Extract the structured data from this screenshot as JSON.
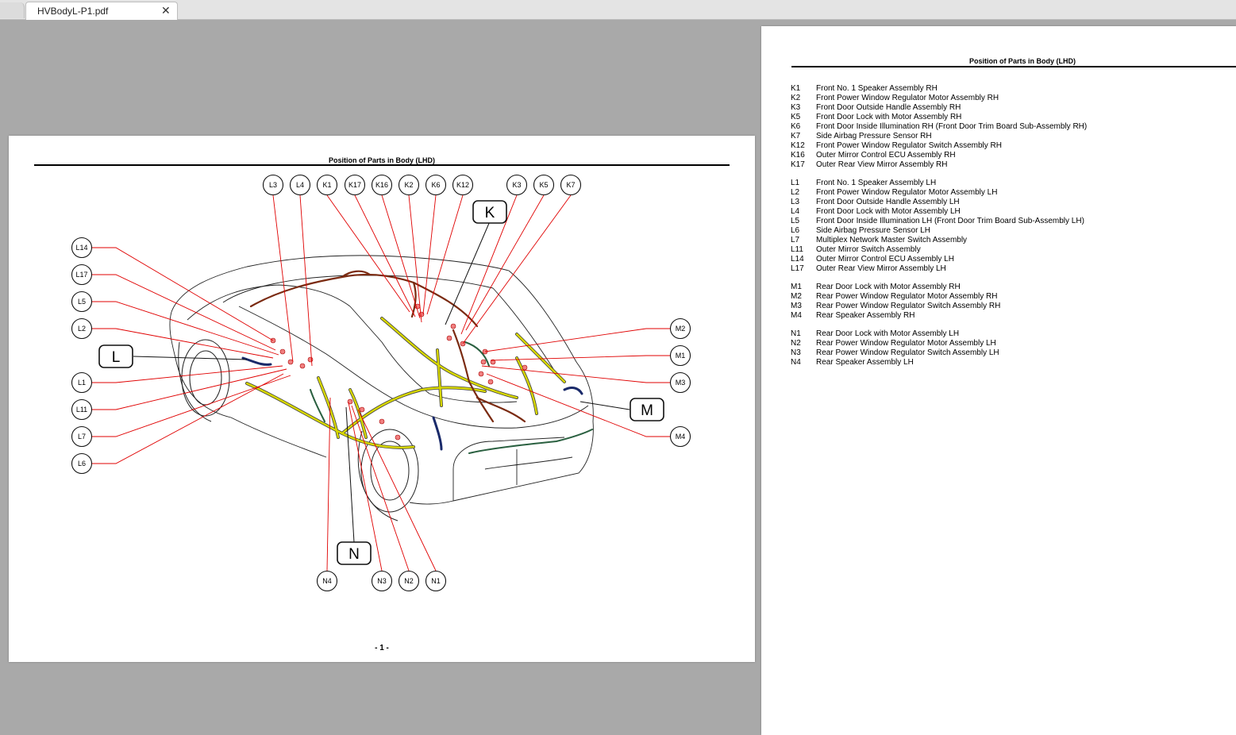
{
  "tab": {
    "title": "HVBodyL-P1.pdf",
    "close": "✕"
  },
  "page1": {
    "title": "Position of Parts in Body (LHD)",
    "page_number": "- 1 -"
  },
  "page2": {
    "title": "Position of Parts in Body (LHD)"
  },
  "groups": [
    {
      "letter": "K"
    },
    {
      "letter": "L"
    },
    {
      "letter": "M"
    },
    {
      "letter": "N"
    }
  ],
  "top_callouts": [
    "L3",
    "L4",
    "K1",
    "K17",
    "K16",
    "K2",
    "K6",
    "K12",
    "K3",
    "K5",
    "K7"
  ],
  "left_callouts": [
    "L14",
    "L17",
    "L5",
    "L2",
    "L1",
    "L11",
    "L7",
    "L6"
  ],
  "right_callouts": [
    "M2",
    "M1",
    "M3",
    "M4"
  ],
  "bottom_callouts": [
    "N4",
    "N3",
    "N2",
    "N1"
  ],
  "legend": [
    {
      "group": "K",
      "items": [
        {
          "code": "K1",
          "name": "Front No. 1 Speaker Assembly RH"
        },
        {
          "code": "K2",
          "name": "Front Power Window Regulator Motor Assembly RH"
        },
        {
          "code": "K3",
          "name": "Front Door Outside Handle Assembly RH"
        },
        {
          "code": "K5",
          "name": "Front Door Lock with Motor Assembly RH"
        },
        {
          "code": "K6",
          "name": "Front Door Inside Illumination RH (Front Door Trim Board Sub-Assembly RH)"
        },
        {
          "code": "K7",
          "name": "Side Airbag Pressure Sensor RH"
        },
        {
          "code": "K12",
          "name": "Front Power Window Regulator Switch Assembly RH"
        },
        {
          "code": "K16",
          "name": "Outer Mirror Control ECU Assembly RH"
        },
        {
          "code": "K17",
          "name": "Outer Rear View Mirror Assembly RH"
        }
      ]
    },
    {
      "group": "L",
      "items": [
        {
          "code": "L1",
          "name": "Front No. 1 Speaker Assembly LH"
        },
        {
          "code": "L2",
          "name": "Front Power Window Regulator Motor Assembly LH"
        },
        {
          "code": "L3",
          "name": "Front Door Outside Handle Assembly LH"
        },
        {
          "code": "L4",
          "name": "Front Door Lock with Motor Assembly LH"
        },
        {
          "code": "L5",
          "name": "Front Door Inside Illumination LH (Front Door Trim Board Sub-Assembly LH)"
        },
        {
          "code": "L6",
          "name": "Side Airbag Pressure Sensor LH"
        },
        {
          "code": "L7",
          "name": "Multiplex Network Master Switch Assembly"
        },
        {
          "code": "L11",
          "name": "Outer Mirror Switch Assembly"
        },
        {
          "code": "L14",
          "name": "Outer Mirror Control ECU Assembly LH"
        },
        {
          "code": "L17",
          "name": "Outer Rear View Mirror Assembly LH"
        }
      ]
    },
    {
      "group": "M",
      "items": [
        {
          "code": "M1",
          "name": "Rear Door Lock with Motor Assembly RH"
        },
        {
          "code": "M2",
          "name": "Rear Power Window Regulator Motor Assembly RH"
        },
        {
          "code": "M3",
          "name": "Rear Power Window Regulator Switch Assembly RH"
        },
        {
          "code": "M4",
          "name": "Rear Speaker Assembly RH"
        }
      ]
    },
    {
      "group": "N",
      "items": [
        {
          "code": "N1",
          "name": "Rear Door Lock with Motor Assembly LH"
        },
        {
          "code": "N2",
          "name": "Rear Power Window Regulator Motor Assembly LH"
        },
        {
          "code": "N3",
          "name": "Rear Power Window Regulator Switch Assembly LH"
        },
        {
          "code": "N4",
          "name": "Rear Speaker Assembly LH"
        }
      ]
    }
  ],
  "colors": {
    "leader": "#e00000",
    "harness_yellow": "#d8d800",
    "harness_brown": "#7a2a10",
    "harness_green": "#2a6040",
    "harness_navy": "#1a2a6a",
    "connector": "#f08080"
  }
}
